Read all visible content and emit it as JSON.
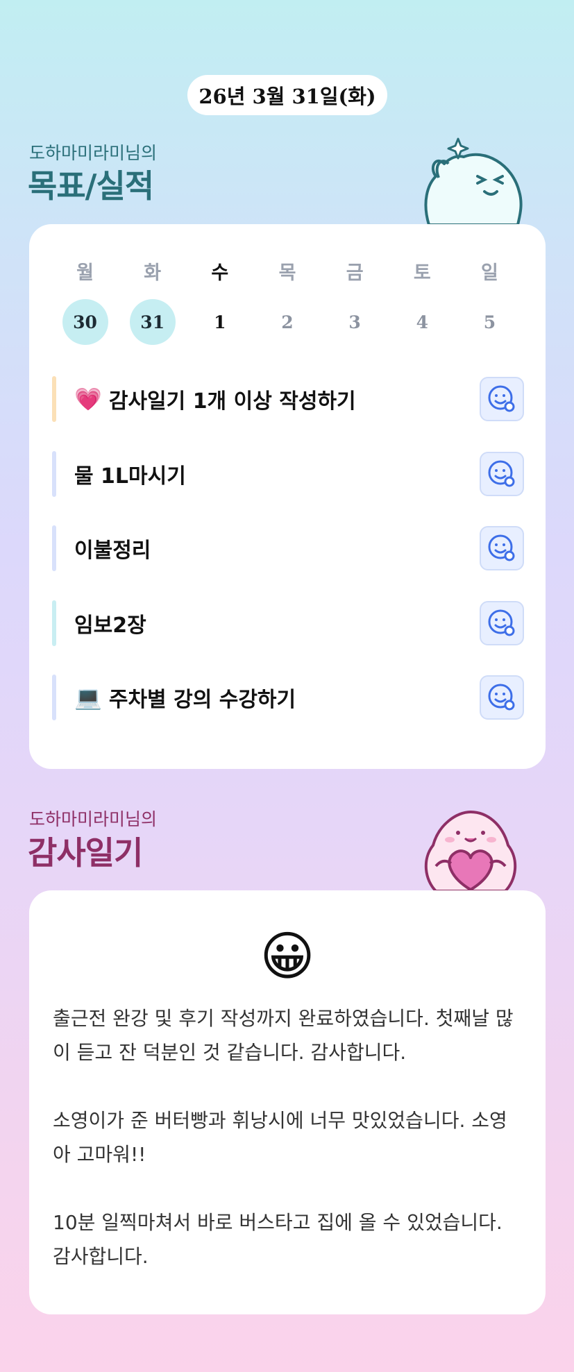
{
  "header": {
    "date": "26년 3월 31일(화)"
  },
  "goals_section": {
    "owner": "도하마미라미님의",
    "title": "목표/실적"
  },
  "week": {
    "days": [
      "월",
      "화",
      "수",
      "목",
      "금",
      "토",
      "일"
    ],
    "dates": [
      "30",
      "31",
      "1",
      "2",
      "3",
      "4",
      "5"
    ]
  },
  "goals": [
    {
      "icon": "💗",
      "text": "감사일기 1개 이상 작성하기",
      "bar_color": "#fbe0b7"
    },
    {
      "icon": "",
      "text": "물 1L마시기",
      "bar_color": "#d8e1fb"
    },
    {
      "icon": "",
      "text": "이불정리",
      "bar_color": "#d8e1fb"
    },
    {
      "icon": "",
      "text": "임보2장",
      "bar_color": "#c9eef2"
    },
    {
      "icon": "💻",
      "text": "주차별 강의 수강하기",
      "bar_color": "#d8e1fb"
    }
  ],
  "diary_section": {
    "owner": "도하마미라미님의",
    "title": "감사일기"
  },
  "diary": {
    "emoji": "😀",
    "paragraphs": [
      "출근전 완강 및 후기 작성까지 완료하였습니다. 첫째날 많이 듣고 잔 덕분인 것 같습니다. 감사합니다.",
      "소영이가 준 버터빵과 휘낭시에 너무 맛있었습니다. 소영아 고마워!!",
      "10분 일찍마쳐서 바로 버스타고 집에 올 수 있었습니다. 감사합니다."
    ]
  },
  "colors": {
    "accent_teal": "#2a6f79",
    "accent_plum": "#8e2f66",
    "highlight": "#c6eef2",
    "button_blue": "#3d6ee8"
  }
}
